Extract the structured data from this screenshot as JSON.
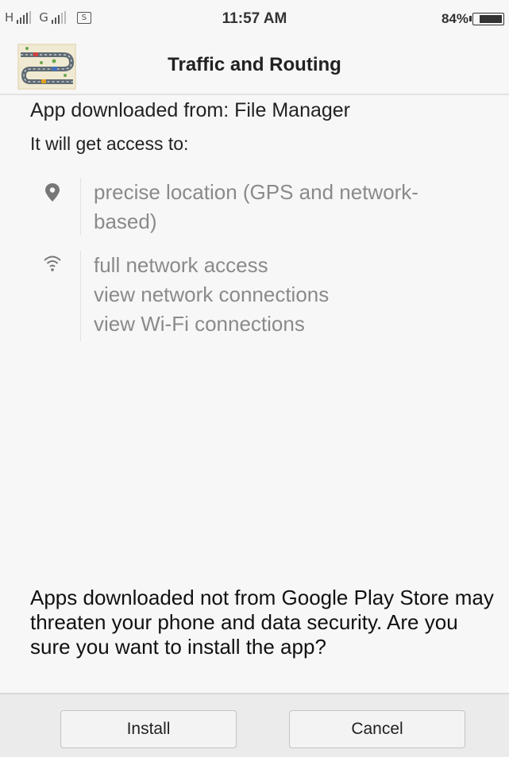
{
  "status_bar": {
    "carrier1": "H",
    "carrier2": "G",
    "sim_label": "S",
    "time": "11:57 AM",
    "battery_percent": "84%",
    "battery_level": 0.84
  },
  "header": {
    "app_icon": "traffic-map-app-icon",
    "title": "Traffic and Routing"
  },
  "install_info": {
    "source_text": "App downloaded from: File Manager",
    "access_intro": "It will get access to:"
  },
  "permissions": [
    {
      "icon": "location-pin-icon",
      "lines": [
        "precise location (GPS and network-",
        "based)"
      ]
    },
    {
      "icon": "wifi-icon",
      "lines": [
        "full network access",
        "view network connections",
        "view Wi-Fi connections"
      ]
    }
  ],
  "warning_text": "Apps downloaded not from Google Play Store may threaten your phone and data security. Are you sure you want to install the app?",
  "buttons": {
    "install_label": "Install",
    "cancel_label": "Cancel"
  },
  "colors": {
    "background": "#f7f7f7",
    "permission_text": "#8a8a8a",
    "button_bar": "#ebebeb"
  }
}
